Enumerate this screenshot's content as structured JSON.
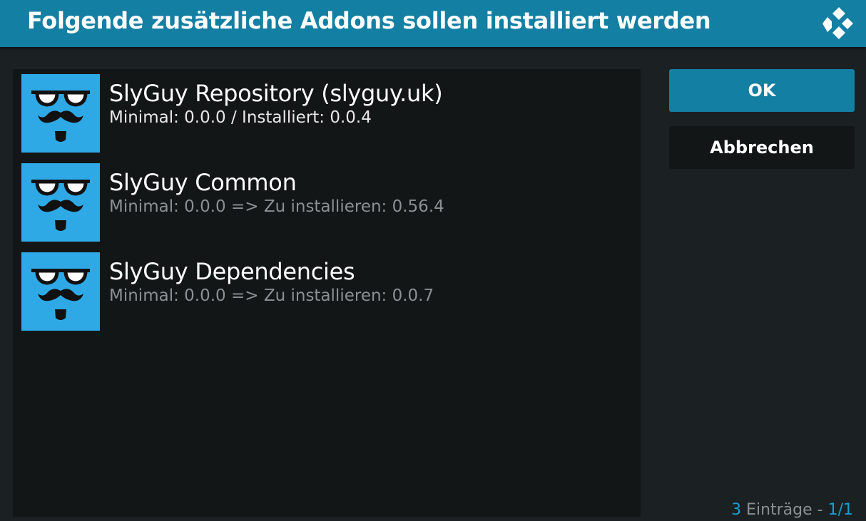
{
  "dialog": {
    "title": "Folgende zusätzliche Addons sollen installiert werden"
  },
  "icons": {
    "logo": "kodi-logo-icon",
    "addon_thumb": "slyguy-glasses-mustache-icon"
  },
  "colors": {
    "header": "#137fa3",
    "thumb_background": "#2ea9e6",
    "accent": "#1a9ed0",
    "list_background": "#131617",
    "page_background": "#1b2023"
  },
  "addons": [
    {
      "name": "SlyGuy Repository (slyguy.uk)",
      "detail": "Minimal: 0.0.0 / Installiert: 0.0.4"
    },
    {
      "name": "SlyGuy Common",
      "detail": "Minimal: 0.0.0 => Zu installieren: 0.56.4"
    },
    {
      "name": "SlyGuy Dependencies",
      "detail": "Minimal: 0.0.0 => Zu installieren: 0.0.7"
    }
  ],
  "buttons": {
    "ok": "OK",
    "cancel": "Abbrechen"
  },
  "footer": {
    "count": "3",
    "label": " Einträge - ",
    "page": "1/1"
  }
}
